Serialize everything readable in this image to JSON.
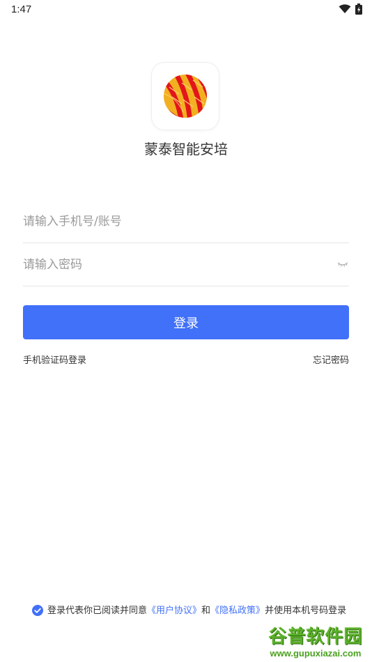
{
  "status_bar": {
    "time": "1:47",
    "icons": [
      "wifi-icon",
      "battery-charging-icon"
    ]
  },
  "app": {
    "name": "蒙泰智能安培",
    "logo": "app-logo-icon"
  },
  "form": {
    "phone_placeholder": "请输入手机号/账号",
    "password_placeholder": "请输入密码",
    "login_label": "登录",
    "sms_login_label": "手机验证码登录",
    "forgot_label": "忘记密码"
  },
  "agreement": {
    "prefix": "登录代表你已阅读并同意",
    "user_agreement": "《用户协议》",
    "and": "和",
    "privacy_policy": "《隐私政策》",
    "suffix": "并使用本机号码登录",
    "checked": true
  },
  "watermark": {
    "title": "谷普软件园",
    "url": "www.gupuxiazai.com"
  },
  "colors": {
    "primary": "#4170f9",
    "text": "#333333",
    "placeholder": "#9a9a9a",
    "divider": "#e5e5e5"
  }
}
